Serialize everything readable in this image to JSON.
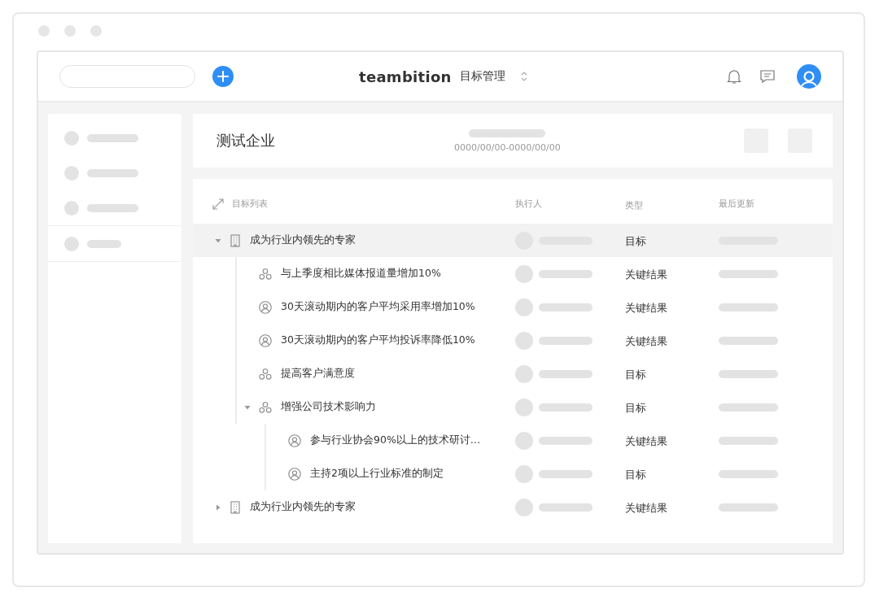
{
  "header": {
    "brand": "teambition",
    "module": "目标管理"
  },
  "page": {
    "title": "测试企业",
    "date_range": "0000/00/00-0000/00/00"
  },
  "table": {
    "columns": [
      "目标列表",
      "执行人",
      "类型",
      "最后更新"
    ],
    "rows": [
      {
        "kind": "building",
        "title": "成为行业内领先的专家",
        "type": "目标",
        "selected": true,
        "expanded": true,
        "children": [
          {
            "kind": "cluster",
            "title": "与上季度相比媒体报道量增加10%",
            "type": "关键结果",
            "selected": false
          },
          {
            "kind": "person",
            "title": "30天滚动期内的客户平均采用率增加10%",
            "type": "关键结果",
            "selected": false
          },
          {
            "kind": "person",
            "title": "30天滚动期内的客户平均投诉率降低10%",
            "type": "关键结果",
            "selected": false
          },
          {
            "kind": "cluster",
            "title": "提高客户满意度",
            "type": "目标",
            "selected": false
          },
          {
            "kind": "cluster",
            "title": "增强公司技术影响力",
            "type": "目标",
            "selected": false,
            "expanded": true,
            "children": [
              {
                "kind": "person",
                "title": "参与行业协会90%以上的技术研讨…",
                "type": "关键结果",
                "selected": false
              },
              {
                "kind": "person",
                "title": "主持2项以上行业标准的制定",
                "type": "目标",
                "selected": false
              }
            ]
          }
        ]
      },
      {
        "kind": "building",
        "title": "成为行业内领先的专家",
        "type": "关键结果",
        "selected": false,
        "expanded": false
      }
    ]
  }
}
